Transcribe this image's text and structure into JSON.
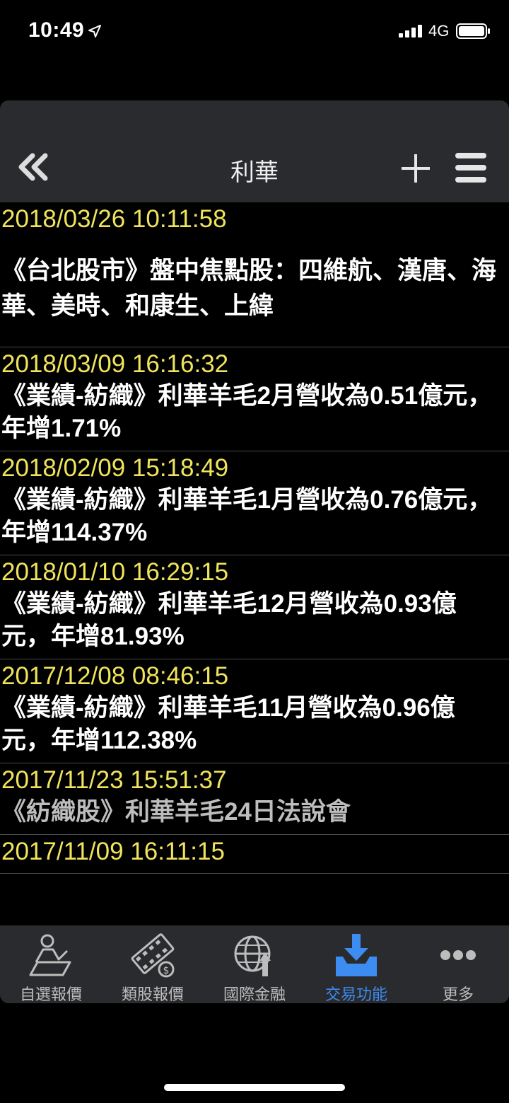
{
  "status": {
    "time": "10:49",
    "network": "4G"
  },
  "nav": {
    "title": "利華"
  },
  "news": [
    {
      "date": "2018/03/26 10:11:58",
      "headline": "《台北股市》盤中焦點股：四維航、漢唐、海華、美時、和康生、上緯"
    },
    {
      "date": "2018/03/09 16:16:32",
      "headline": "《業績-紡織》利華羊毛2月營收為0.51億元，年增1.71%"
    },
    {
      "date": "2018/02/09 15:18:49",
      "headline": "《業績-紡織》利華羊毛1月營收為0.76億元，年增114.37%"
    },
    {
      "date": "2018/01/10 16:29:15",
      "headline": "《業績-紡織》利華羊毛12月營收為0.93億元，年增81.93%"
    },
    {
      "date": "2017/12/08 08:46:15",
      "headline": "《業績-紡織》利華羊毛11月營收為0.96億元，年增112.38%"
    },
    {
      "date": "2017/11/23 15:51:37",
      "headline": "《紡織股》利華羊毛24日法說會"
    },
    {
      "date": "2017/11/09 16:11:15",
      "headline": ""
    }
  ],
  "tabs": [
    {
      "label": "自選報價",
      "icon": "watchlist-icon"
    },
    {
      "label": "類股報價",
      "icon": "sector-quote-icon"
    },
    {
      "label": "國際金融",
      "icon": "global-finance-icon"
    },
    {
      "label": "交易功能",
      "icon": "trade-icon",
      "active": true
    },
    {
      "label": "更多",
      "icon": "more-icon"
    }
  ],
  "colors": {
    "date": "#f0e45c",
    "active_tab": "#3d8cf2",
    "bar_bg": "#2a2b2e"
  }
}
